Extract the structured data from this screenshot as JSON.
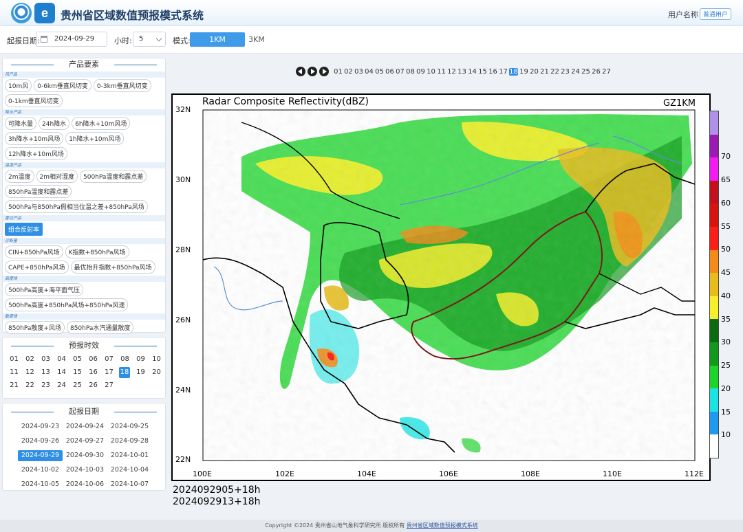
{
  "header": {
    "title": "贵州省区域数值预报模式系统",
    "user_name": "用户名称",
    "user_role": "普通用户"
  },
  "toolbar": {
    "start_date_label": "起报日期:",
    "start_date_value": "2024-09-29",
    "hour_label": "小时:",
    "hour_value": "5",
    "mode_label": "模式:",
    "mode_active": "1KM",
    "mode_other": "3KM"
  },
  "products": {
    "title": "产品要素",
    "groups": [
      {
        "category": "风产品",
        "items": [
          "10m风",
          "0-6km垂直风切变",
          "0-3km垂直风切变",
          "0-1km垂直风切变"
        ]
      },
      {
        "category": "降水产品",
        "items": [
          "可降水量",
          "24h降水",
          "6h降水+10m风场",
          "3h降水+10m风场",
          "1h降水+10m风场",
          "12h降水+10m风场"
        ]
      },
      {
        "category": "温湿产品",
        "items": [
          "2m温度",
          "2m相对湿度",
          "500hPa温度和露点差",
          "850hPa温度和露点差",
          "500hPa与850hPa假相当位温之差+850hPa风场"
        ]
      },
      {
        "category": "雷达产品",
        "items": [
          "组合反射率"
        ]
      },
      {
        "category": "诊断量",
        "items": [
          "CIN+850hPa风场",
          "K指数+850hPa风场",
          "CAPE+850hPa风场",
          "最优抬升指数+850hPa风场"
        ]
      },
      {
        "category": "高度场",
        "items": [
          "500hPa高度+海平面气压",
          "500hPa高度+850hPa风场+850hPa风速"
        ]
      },
      {
        "category": "散度场",
        "items": [
          "850hPa散度+风场",
          "850hPa水汽通量散度"
        ]
      }
    ],
    "active_item": "组合反射率"
  },
  "forecast_times": {
    "title": "预报时效",
    "items": [
      "01",
      "02",
      "03",
      "04",
      "05",
      "06",
      "07",
      "08",
      "09",
      "10",
      "11",
      "12",
      "13",
      "14",
      "15",
      "16",
      "17",
      "18",
      "19",
      "20",
      "21",
      "22",
      "23",
      "24",
      "25",
      "26",
      "27"
    ],
    "active": "18"
  },
  "start_dates": {
    "title": "起报日期",
    "items": [
      "2024-09-23",
      "2024-09-24",
      "2024-09-25",
      "2024-09-26",
      "2024-09-27",
      "2024-09-28",
      "2024-09-29",
      "2024-09-30",
      "2024-10-01",
      "2024-10-02",
      "2024-10-03",
      "2024-10-04",
      "2024-10-05",
      "2024-10-06",
      "2024-10-07"
    ],
    "active": "2024-09-29"
  },
  "map": {
    "title": "Radar Composite Reflectivity(dBZ)",
    "model_code": "GZ1KM",
    "lat_labels": [
      "32N",
      "30N",
      "28N",
      "26N",
      "24N",
      "22N"
    ],
    "lon_labels": [
      "100E",
      "102E",
      "104E",
      "106E",
      "108E",
      "110E",
      "112E"
    ],
    "colorbar_labels": [
      "10",
      "15",
      "20",
      "25",
      "30",
      "35",
      "40",
      "45",
      "50",
      "55",
      "60",
      "65",
      "70"
    ],
    "colorbar_colors": [
      "#ffffff",
      "#1e9bf0",
      "#19e3e3",
      "#1cd42a",
      "#129a1e",
      "#0c6a10",
      "#f7ef2c",
      "#e7bc1d",
      "#f68a18",
      "#fb1f18",
      "#d8140f",
      "#c2101e",
      "#f21cf1",
      "#9a1ab4",
      "#b190ea"
    ],
    "run_lines": [
      "2024092905+18h",
      "2024092913+18h"
    ]
  },
  "footer": {
    "text": "Copyright ©2024  贵州省山地气象科学研究所  版权所有",
    "link": "贵州省区域数值预报模式系统"
  }
}
